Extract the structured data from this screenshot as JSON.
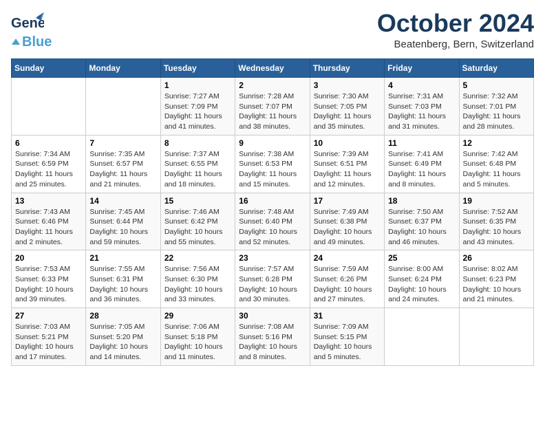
{
  "header": {
    "logo_general": "General",
    "logo_blue": "Blue",
    "month": "October 2024",
    "location": "Beatenberg, Bern, Switzerland"
  },
  "columns": [
    "Sunday",
    "Monday",
    "Tuesday",
    "Wednesday",
    "Thursday",
    "Friday",
    "Saturday"
  ],
  "weeks": [
    [
      {
        "day": "",
        "info": ""
      },
      {
        "day": "",
        "info": ""
      },
      {
        "day": "1",
        "info": "Sunrise: 7:27 AM\nSunset: 7:09 PM\nDaylight: 11 hours and 41 minutes."
      },
      {
        "day": "2",
        "info": "Sunrise: 7:28 AM\nSunset: 7:07 PM\nDaylight: 11 hours and 38 minutes."
      },
      {
        "day": "3",
        "info": "Sunrise: 7:30 AM\nSunset: 7:05 PM\nDaylight: 11 hours and 35 minutes."
      },
      {
        "day": "4",
        "info": "Sunrise: 7:31 AM\nSunset: 7:03 PM\nDaylight: 11 hours and 31 minutes."
      },
      {
        "day": "5",
        "info": "Sunrise: 7:32 AM\nSunset: 7:01 PM\nDaylight: 11 hours and 28 minutes."
      }
    ],
    [
      {
        "day": "6",
        "info": "Sunrise: 7:34 AM\nSunset: 6:59 PM\nDaylight: 11 hours and 25 minutes."
      },
      {
        "day": "7",
        "info": "Sunrise: 7:35 AM\nSunset: 6:57 PM\nDaylight: 11 hours and 21 minutes."
      },
      {
        "day": "8",
        "info": "Sunrise: 7:37 AM\nSunset: 6:55 PM\nDaylight: 11 hours and 18 minutes."
      },
      {
        "day": "9",
        "info": "Sunrise: 7:38 AM\nSunset: 6:53 PM\nDaylight: 11 hours and 15 minutes."
      },
      {
        "day": "10",
        "info": "Sunrise: 7:39 AM\nSunset: 6:51 PM\nDaylight: 11 hours and 12 minutes."
      },
      {
        "day": "11",
        "info": "Sunrise: 7:41 AM\nSunset: 6:49 PM\nDaylight: 11 hours and 8 minutes."
      },
      {
        "day": "12",
        "info": "Sunrise: 7:42 AM\nSunset: 6:48 PM\nDaylight: 11 hours and 5 minutes."
      }
    ],
    [
      {
        "day": "13",
        "info": "Sunrise: 7:43 AM\nSunset: 6:46 PM\nDaylight: 11 hours and 2 minutes."
      },
      {
        "day": "14",
        "info": "Sunrise: 7:45 AM\nSunset: 6:44 PM\nDaylight: 10 hours and 59 minutes."
      },
      {
        "day": "15",
        "info": "Sunrise: 7:46 AM\nSunset: 6:42 PM\nDaylight: 10 hours and 55 minutes."
      },
      {
        "day": "16",
        "info": "Sunrise: 7:48 AM\nSunset: 6:40 PM\nDaylight: 10 hours and 52 minutes."
      },
      {
        "day": "17",
        "info": "Sunrise: 7:49 AM\nSunset: 6:38 PM\nDaylight: 10 hours and 49 minutes."
      },
      {
        "day": "18",
        "info": "Sunrise: 7:50 AM\nSunset: 6:37 PM\nDaylight: 10 hours and 46 minutes."
      },
      {
        "day": "19",
        "info": "Sunrise: 7:52 AM\nSunset: 6:35 PM\nDaylight: 10 hours and 43 minutes."
      }
    ],
    [
      {
        "day": "20",
        "info": "Sunrise: 7:53 AM\nSunset: 6:33 PM\nDaylight: 10 hours and 39 minutes."
      },
      {
        "day": "21",
        "info": "Sunrise: 7:55 AM\nSunset: 6:31 PM\nDaylight: 10 hours and 36 minutes."
      },
      {
        "day": "22",
        "info": "Sunrise: 7:56 AM\nSunset: 6:30 PM\nDaylight: 10 hours and 33 minutes."
      },
      {
        "day": "23",
        "info": "Sunrise: 7:57 AM\nSunset: 6:28 PM\nDaylight: 10 hours and 30 minutes."
      },
      {
        "day": "24",
        "info": "Sunrise: 7:59 AM\nSunset: 6:26 PM\nDaylight: 10 hours and 27 minutes."
      },
      {
        "day": "25",
        "info": "Sunrise: 8:00 AM\nSunset: 6:24 PM\nDaylight: 10 hours and 24 minutes."
      },
      {
        "day": "26",
        "info": "Sunrise: 8:02 AM\nSunset: 6:23 PM\nDaylight: 10 hours and 21 minutes."
      }
    ],
    [
      {
        "day": "27",
        "info": "Sunrise: 7:03 AM\nSunset: 5:21 PM\nDaylight: 10 hours and 17 minutes."
      },
      {
        "day": "28",
        "info": "Sunrise: 7:05 AM\nSunset: 5:20 PM\nDaylight: 10 hours and 14 minutes."
      },
      {
        "day": "29",
        "info": "Sunrise: 7:06 AM\nSunset: 5:18 PM\nDaylight: 10 hours and 11 minutes."
      },
      {
        "day": "30",
        "info": "Sunrise: 7:08 AM\nSunset: 5:16 PM\nDaylight: 10 hours and 8 minutes."
      },
      {
        "day": "31",
        "info": "Sunrise: 7:09 AM\nSunset: 5:15 PM\nDaylight: 10 hours and 5 minutes."
      },
      {
        "day": "",
        "info": ""
      },
      {
        "day": "",
        "info": ""
      }
    ]
  ]
}
